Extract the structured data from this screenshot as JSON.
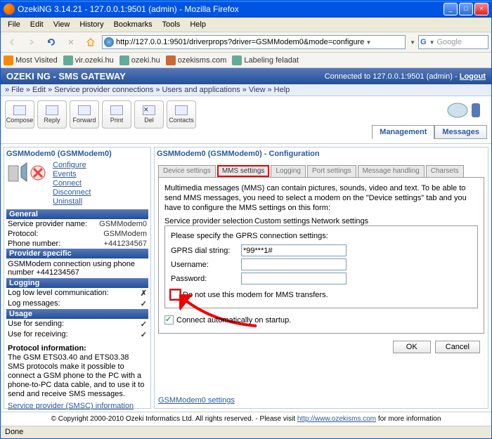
{
  "window_title": "OzekiNG 3.14.21 - 127.0.0.1:9501 (admin) - Mozilla Firefox",
  "menubar": {
    "file": "File",
    "edit": "Edit",
    "view": "View",
    "history": "History",
    "bookmarks": "Bookmarks",
    "tools": "Tools",
    "help": "Help"
  },
  "url": "http://127.0.0.1:9501/driverprops?driver=GSMModem0&mode=configure",
  "search_placeholder": "Google",
  "bookmarks": {
    "most": "Most Visited",
    "vir": "vir.ozeki.hu",
    "ozeki": "ozeki.hu",
    "sms": "ozekisms.com",
    "label": "Labeling feladat"
  },
  "app": {
    "title": "OZEKI NG - SMS GATEWAY",
    "connected": "Connected to 127.0.0.1:9501 (admin) - ",
    "logout": "Logout"
  },
  "topmenu": {
    "file": "File",
    "edit": "Edit",
    "spc": "Service provider connections",
    "users": "Users and applications",
    "view": "View",
    "help": "Help"
  },
  "toolbar": {
    "compose": "Compose",
    "reply": "Reply",
    "forward": "Forward",
    "print": "Print",
    "del": "Del",
    "contacts": "Contacts"
  },
  "maintabs": {
    "management": "Management",
    "messages": "Messages"
  },
  "left": {
    "title": "GSMModem0 (GSMModem0)",
    "links": {
      "configure": "Configure",
      "events": "Events",
      "connect": "Connect",
      "disconnect": "Disconnect",
      "uninstall": "Uninstall"
    },
    "general": "General",
    "spn_l": "Service provider name:",
    "spn_v": "GSMModem0",
    "proto_l": "Protocol:",
    "proto_v": "GSMModem",
    "phone_l": "Phone number:",
    "phone_v": "+441234567",
    "provider": "Provider specific",
    "provider_text": "GSMModem connection using phone number +441234567",
    "logging": "Logging",
    "log1": "Log low level communication:",
    "log2": "Log messages:",
    "usage": "Usage",
    "use1": "Use for sending:",
    "use2": "Use for receiving:",
    "proto_h": "Protocol information:",
    "proto_text": "The GSM ETS03.40 and ETS03.38 SMS protocols make it possible to connect a GSM phone to the PC with a phone-to-PC data cable, and to use it to send and receive SMS messages.",
    "bottom": "Service provider (SMSC) information"
  },
  "right": {
    "title": "GSMModem0 (GSMModem0) - Configuration",
    "tabs": {
      "device": "Device settings",
      "mms": "MMS settings",
      "logging": "Logging",
      "port": "Port settings",
      "msg": "Message handling",
      "charset": "Charsets"
    },
    "intro": "Multimedia messages (MMS) can contain pictures, sounds, video and text. To be able to send MMS messages, you need to select a modem on the \"Device settings\" tab and you have to configure the MMS settings on this form:",
    "subtabs": {
      "spsel": "Service provider selection",
      "custom": "Custom settings",
      "net": "Network settings"
    },
    "gprs_h": "Please specify the GPRS connection settings:",
    "dial_l": "GPRS dial string:",
    "dial_v": "*99***1#",
    "user_l": "Username:",
    "pass_l": "Password:",
    "cb1": "Do not use this modem for MMS transfers.",
    "cb2": "Connect automatically on startup.",
    "ok": "OK",
    "cancel": "Cancel",
    "bottom": "GSMModem0 settings"
  },
  "footer": "© Copyright 2000-2010 Ozeki Informatics Ltd. All rights reserved. - Please visit ",
  "footer_link": "http://www.ozekisms.com",
  "footer_tail": " for more information",
  "status": "Done"
}
